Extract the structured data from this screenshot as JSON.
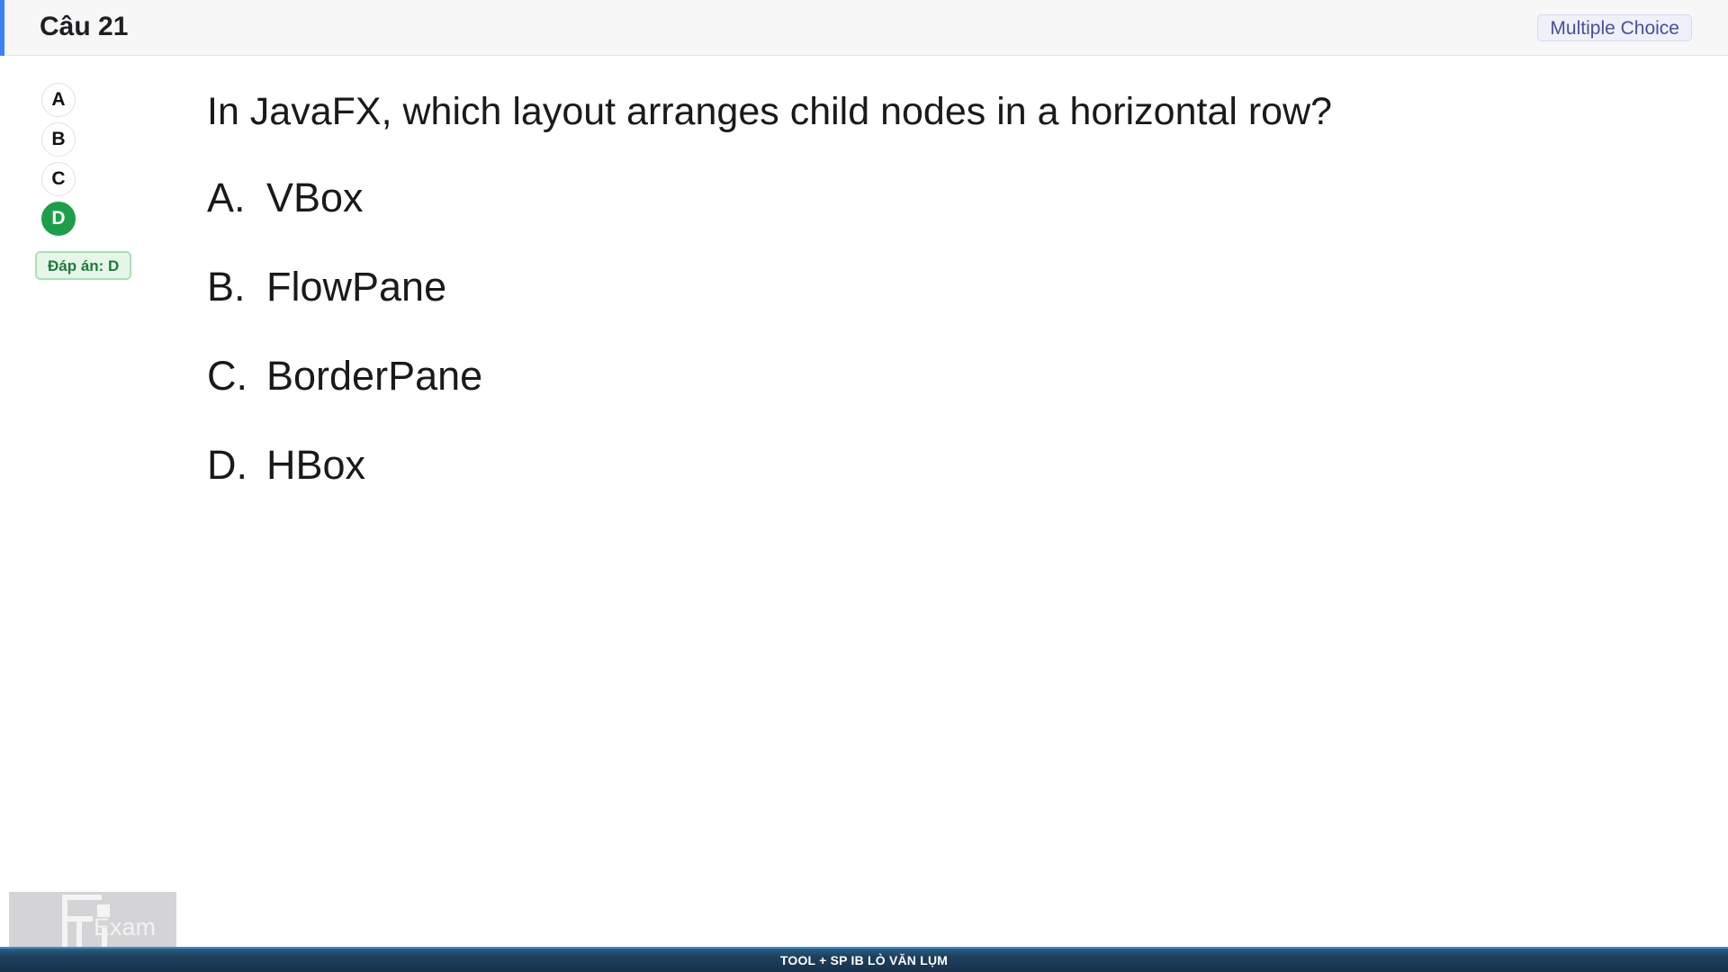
{
  "header": {
    "question_number": "Câu 21",
    "type_badge": "Multiple Choice",
    "accent_color": "#3b82f6"
  },
  "options_rail": {
    "items": [
      {
        "label": "A",
        "selected": false
      },
      {
        "label": "B",
        "selected": false
      },
      {
        "label": "C",
        "selected": false
      },
      {
        "label": "D",
        "selected": true
      }
    ],
    "answer_tag": "Đáp án: D",
    "selected_color": "#1e9e4a"
  },
  "question": {
    "text": "In JavaFX, which layout arranges child nodes in a horizontal row?",
    "choices": [
      {
        "letter": "A.",
        "text": "VBox"
      },
      {
        "letter": "B.",
        "text": "FlowPane"
      },
      {
        "letter": "C.",
        "text": "BorderPane"
      },
      {
        "letter": "D.",
        "text": "HBox"
      }
    ]
  },
  "logo": {
    "mark": "FU",
    "text": "Exam",
    "icon": "fu-exam-logo"
  },
  "footer": {
    "text": "TOOL + SP IB LÒ VĂN LỤM"
  }
}
